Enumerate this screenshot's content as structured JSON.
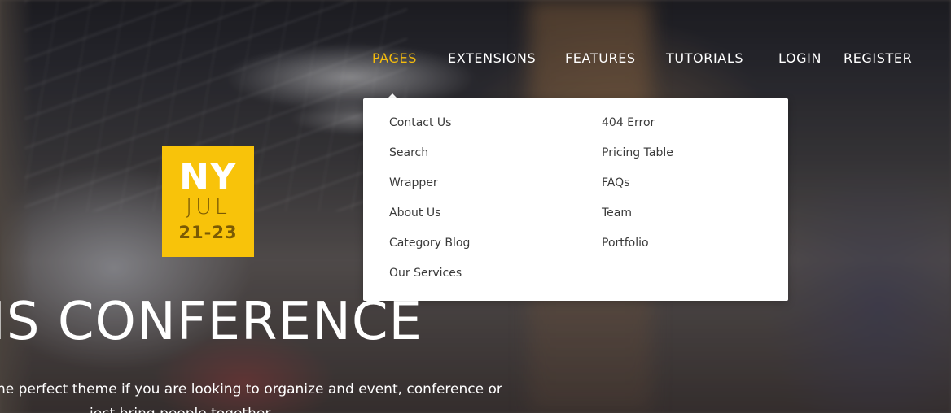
{
  "nav": {
    "items": [
      {
        "label": "PAGES",
        "active": true
      },
      {
        "label": "EXTENSIONS",
        "active": false
      },
      {
        "label": "FEATURES",
        "active": false
      },
      {
        "label": "TUTORIALS",
        "active": false
      }
    ],
    "login_label": "LOGIN",
    "register_label": "REGISTER",
    "active_color": "#f6bd0c"
  },
  "dropdown": {
    "left_column": [
      "Contact Us",
      "Search",
      "Wrapper",
      "About Us",
      "Category Blog",
      "Our Services"
    ],
    "right_column": [
      "404 Error",
      "Pricing Table",
      "FAQs",
      "Team",
      "Portfolio"
    ]
  },
  "badge": {
    "city": "NY",
    "month": "JUL",
    "days": "21-23",
    "color": "#f8c30a"
  },
  "hero": {
    "title": "IS CONFERENCE",
    "subtitle": "he perfect theme if you are looking to organize and event, conference or",
    "subtitle_line2": "ject bring people together."
  }
}
